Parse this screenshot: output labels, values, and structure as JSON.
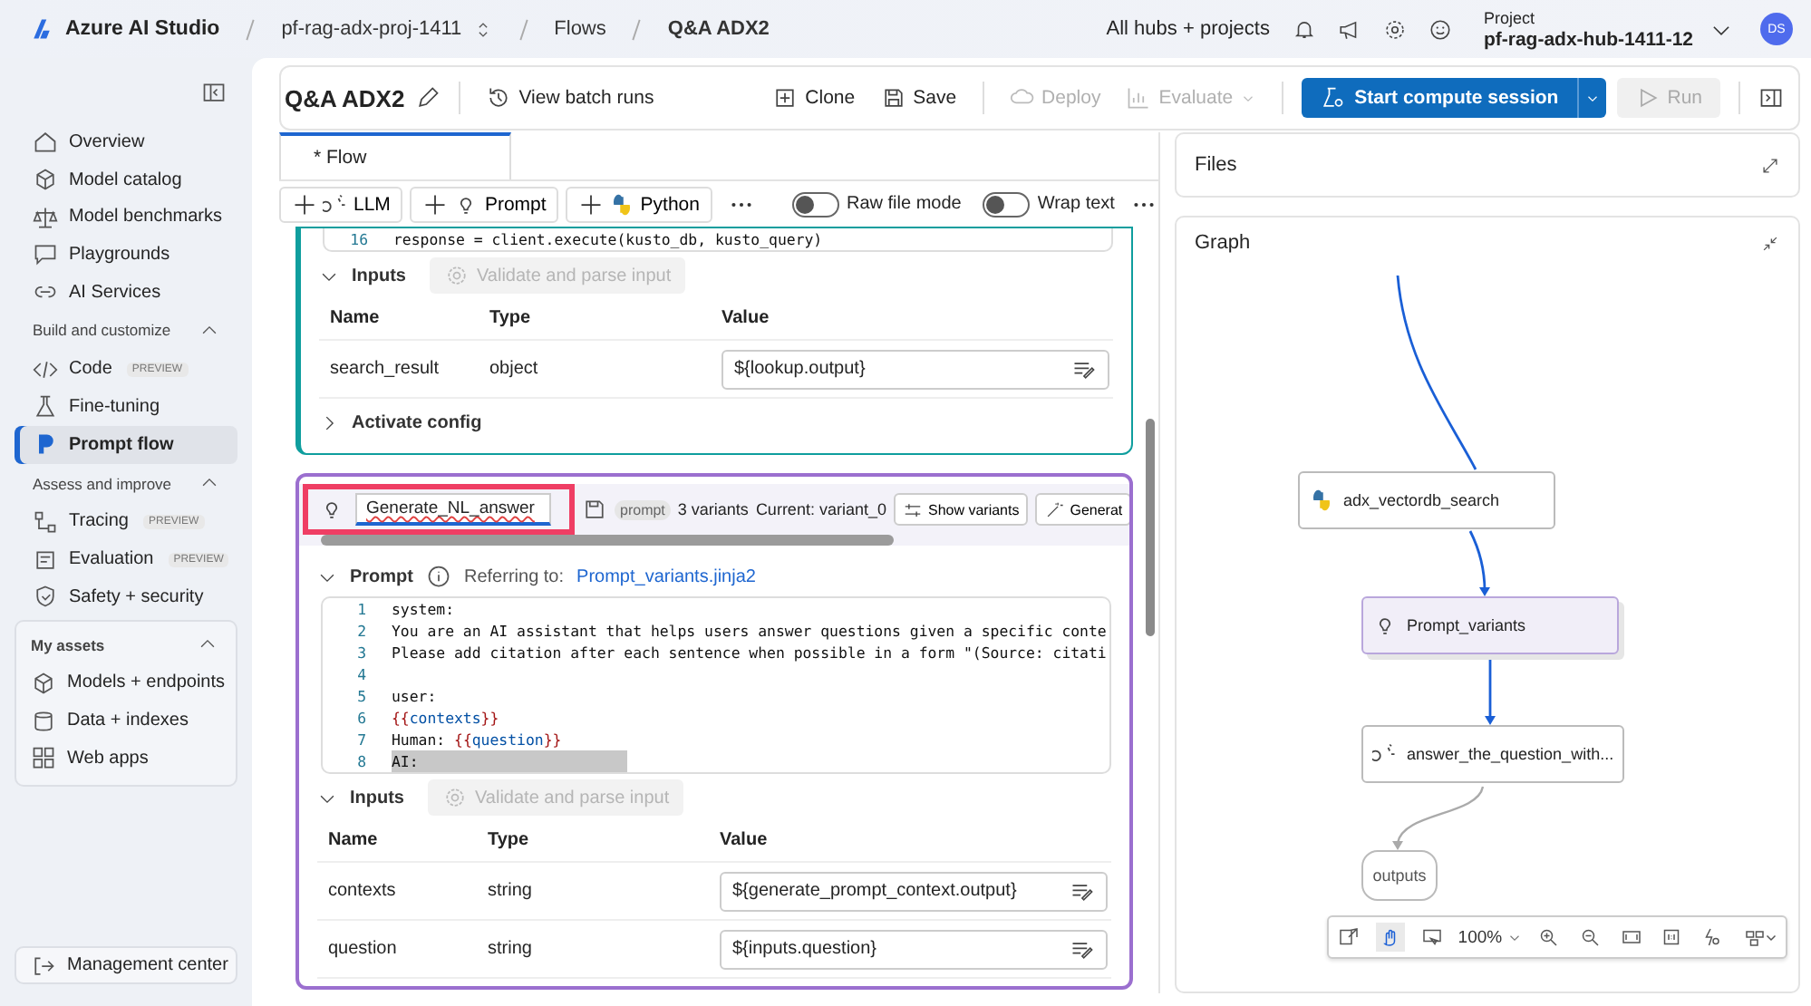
{
  "top_bar": {
    "brand": "Azure AI Studio",
    "breadcrumbs": [
      {
        "label": "pf-rag-adx-proj-1411",
        "switcher": true
      },
      {
        "label": "Flows",
        "switcher": false
      },
      {
        "label": "Q&A ADX2",
        "switcher": false
      }
    ],
    "hub_link": "All hubs + projects",
    "project_label": "Project",
    "project_name": "pf-rag-adx-hub-1411-12",
    "avatar": "DS"
  },
  "sidebar": {
    "groups": [
      {
        "items": [
          {
            "label": "Overview",
            "selected": false
          },
          {
            "label": "Model catalog",
            "selected": false
          },
          {
            "label": "Model benchmarks",
            "selected": false
          },
          {
            "label": "Playgrounds",
            "selected": false
          },
          {
            "label": "AI Services",
            "selected": false
          }
        ]
      },
      {
        "title": "Build and customize",
        "expanded": true,
        "items": [
          {
            "label": "Code",
            "selected": false,
            "badge": "PREVIEW"
          },
          {
            "label": "Fine-tuning",
            "selected": false
          },
          {
            "label": "Prompt flow",
            "selected": true
          }
        ]
      },
      {
        "title": "Assess and improve",
        "expanded": true,
        "items": [
          {
            "label": "Tracing",
            "selected": false,
            "badge": "PREVIEW"
          },
          {
            "label": "Evaluation",
            "selected": false,
            "badge": "PREVIEW"
          },
          {
            "label": "Safety + security",
            "selected": false
          }
        ]
      }
    ],
    "assets": {
      "title": "My assets",
      "expanded": true,
      "items": [
        {
          "label": "Models + endpoints",
          "selected": false
        },
        {
          "label": "Data + indexes",
          "selected": false
        },
        {
          "label": "Web apps",
          "selected": false
        }
      ]
    },
    "footer_button": "Management center"
  },
  "toolbar": {
    "title": "Q&A ADX2",
    "batch_runs": "View batch runs",
    "actions": [
      {
        "label": "Clone",
        "disabled": false,
        "menu": false
      },
      {
        "label": "Save",
        "disabled": false,
        "menu": false
      },
      {
        "label": "Deploy",
        "disabled": true,
        "menu": false
      },
      {
        "label": "Evaluate",
        "disabled": true,
        "menu": true
      }
    ],
    "primary": "Start compute session",
    "run": {
      "label": "Run",
      "disabled": true
    }
  },
  "tabs": [
    {
      "label": "* Flow",
      "selected": true
    }
  ],
  "node_toolbar": {
    "add_buttons": [
      "LLM",
      "Prompt",
      "Python"
    ],
    "toggles": [
      {
        "label": "Raw file mode",
        "on": false
      },
      {
        "label": "Wrap text",
        "on": false
      }
    ]
  },
  "nodes": [
    {
      "color": "#0f9e9e",
      "code_tail": {
        "number": "16",
        "text": "response = client.execute(kusto_db, kusto_query)"
      },
      "inputs_label": "Inputs",
      "inputs_expanded": true,
      "validate": "Validate and parse input",
      "columns": [
        "Name",
        "Type",
        "Value"
      ],
      "rows": [
        {
          "name": "search_result",
          "type": "object",
          "value": "${lookup.output}"
        }
      ],
      "config": {
        "label": "Activate config",
        "expanded": false
      }
    },
    {
      "color": "#9b6fcf",
      "name": "Generate_NL_answer",
      "highlighted": true,
      "tag": "prompt",
      "variants": "3 variants",
      "current": "Current: variant_0",
      "buttons": [
        "Show variants",
        "Generat"
      ],
      "prompt": {
        "label": "Prompt",
        "expanded": true,
        "referring": "Referring to:",
        "link": "Prompt_variants.jinja2"
      },
      "code": [
        {
          "number": "1",
          "highlighted": false,
          "tokens": [
            {
              "kind": "plain",
              "text": "system:"
            }
          ]
        },
        {
          "number": "2",
          "highlighted": false,
          "tokens": [
            {
              "kind": "plain",
              "text": "You are an AI assistant that helps users answer questions given a specific conte"
            }
          ]
        },
        {
          "number": "3",
          "highlighted": false,
          "tokens": [
            {
              "kind": "plain",
              "text": "Please add citation after each sentence when possible in a form \"(Source: citati"
            }
          ]
        },
        {
          "number": "4",
          "highlighted": false
        },
        {
          "number": "5",
          "highlighted": false,
          "tokens": [
            {
              "kind": "plain",
              "text": "user:"
            }
          ]
        },
        {
          "number": "6",
          "highlighted": false,
          "tokens": [
            {
              "kind": "brace",
              "text": "{{"
            },
            {
              "kind": "var",
              "text": "contexts"
            },
            {
              "kind": "brace",
              "text": "}}"
            }
          ]
        },
        {
          "number": "7",
          "highlighted": false,
          "tokens": [
            {
              "kind": "plain",
              "text": "Human: "
            },
            {
              "kind": "brace",
              "text": "{{"
            },
            {
              "kind": "var",
              "text": "question"
            },
            {
              "kind": "brace",
              "text": "}}"
            }
          ]
        },
        {
          "number": "8",
          "highlighted": true,
          "tokens": [
            {
              "kind": "plain",
              "text": "AI:"
            }
          ]
        }
      ],
      "inputs_label": "Inputs",
      "inputs_expanded": true,
      "validate": "Validate and parse input",
      "columns": [
        "Name",
        "Type",
        "Value"
      ],
      "rows": [
        {
          "name": "contexts",
          "type": "string",
          "value": "${generate_prompt_context.output}"
        },
        {
          "name": "question",
          "type": "string",
          "value": "${inputs.question}"
        }
      ]
    }
  ],
  "files": {
    "title": "Files"
  },
  "graph": {
    "title": "Graph",
    "nodes": [
      {
        "label": "adx_vectordb_search",
        "kind": "python",
        "selected": false
      },
      {
        "label": "Prompt_variants",
        "kind": "prompt",
        "selected": true
      },
      {
        "label": "answer_the_question_with...",
        "kind": "llm",
        "selected": false
      },
      {
        "label": "outputs",
        "kind": "output",
        "selected": false
      }
    ],
    "tools": [
      {
        "selected": false
      },
      {
        "selected": true
      },
      {
        "selected": false
      }
    ],
    "zoom": "100%"
  }
}
